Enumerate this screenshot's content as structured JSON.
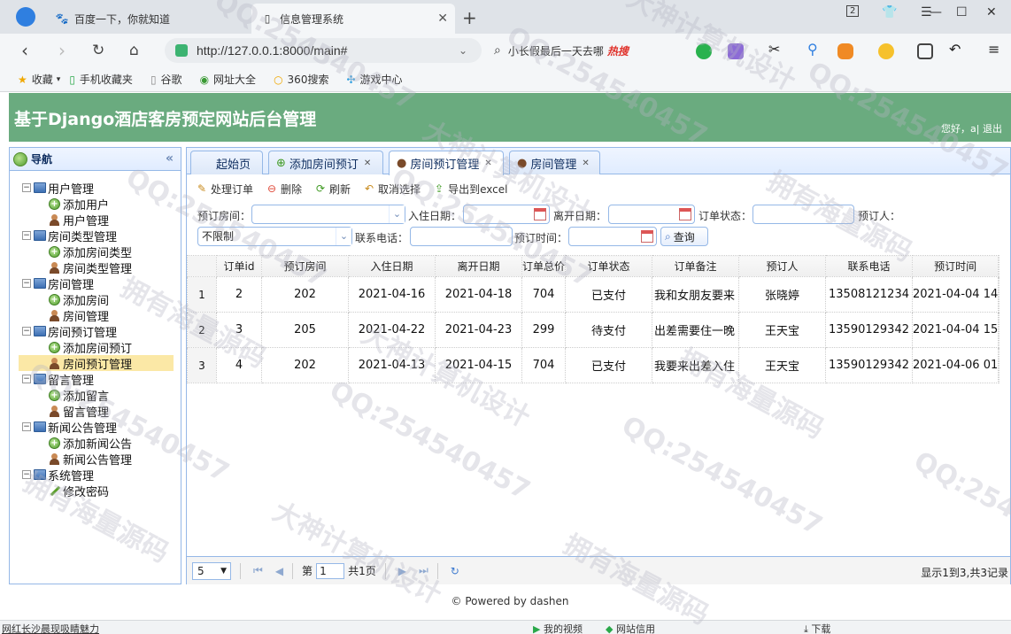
{
  "browser": {
    "tabs": [
      {
        "label": "百度一下，你就知道"
      },
      {
        "label": "信息管理系统"
      }
    ],
    "url": "http://127.0.0.1:8000/main#",
    "search_text": "小长假最后一天去哪",
    "search_hot": "热搜",
    "page_count_badge": "2",
    "bookmarks": [
      "收藏",
      "手机收藏夹",
      "谷歌",
      "网址大全",
      "360搜索",
      "游戏中心"
    ]
  },
  "header": {
    "title": "基于Django酒店客房预定网站后台管理",
    "welcome": "您好，a|",
    "logout": "退出"
  },
  "nav": {
    "title": "导航",
    "groups": [
      {
        "label": "用户管理",
        "children": [
          {
            "label": "添加用户",
            "icon": "add-icon"
          },
          {
            "label": "用户管理",
            "icon": "user-icon"
          }
        ]
      },
      {
        "label": "房间类型管理",
        "children": [
          {
            "label": "添加房间类型",
            "icon": "add-icon"
          },
          {
            "label": "房间类型管理",
            "icon": "user-icon"
          }
        ]
      },
      {
        "label": "房间管理",
        "children": [
          {
            "label": "添加房间",
            "icon": "add-icon"
          },
          {
            "label": "房间管理",
            "icon": "user-icon"
          }
        ]
      },
      {
        "label": "房间预订管理",
        "children": [
          {
            "label": "添加房间预订",
            "icon": "add-icon"
          },
          {
            "label": "房间预订管理",
            "icon": "user-icon"
          }
        ]
      },
      {
        "label": "留言管理",
        "children": [
          {
            "label": "添加留言",
            "icon": "add-icon"
          },
          {
            "label": "留言管理",
            "icon": "user-icon"
          }
        ]
      },
      {
        "label": "新闻公告管理",
        "children": [
          {
            "label": "添加新闻公告",
            "icon": "add-icon"
          },
          {
            "label": "新闻公告管理",
            "icon": "user-icon"
          }
        ]
      },
      {
        "label": "系统管理",
        "children": [
          {
            "label": "修改密码",
            "icon": "pencil-icon"
          }
        ]
      }
    ]
  },
  "content_tabs": [
    "起始页",
    "添加房间预订",
    "房间预订管理",
    "房间管理"
  ],
  "toolbar": {
    "process": "处理订单",
    "delete": "删除",
    "refresh": "刷新",
    "cancel_select": "取消选择",
    "export": "导出到excel"
  },
  "filters": {
    "room_label": "预订房间：",
    "checkin_label": "入住日期：",
    "checkout_label": "离开日期：",
    "status_label": "订单状态：",
    "booker_label": "预订人：",
    "status_value": "不限制",
    "phone_label": "联系电话：",
    "booktime_label": "预订时间：",
    "query": "查询"
  },
  "grid": {
    "columns": [
      "订单id",
      "预订房间",
      "入住日期",
      "离开日期",
      "订单总价",
      "订单状态",
      "订单备注",
      "预订人",
      "联系电话",
      "预订时间"
    ],
    "rows": [
      {
        "rn": "1",
        "cells": [
          "2",
          "202",
          "2021-04-16",
          "2021-04-18",
          "704",
          "已支付",
          "我和女朋友要来",
          "张晓婷",
          "13508121234",
          "2021-04-04 14"
        ]
      },
      {
        "rn": "2",
        "cells": [
          "3",
          "205",
          "2021-04-22",
          "2021-04-23",
          "299",
          "待支付",
          "出差需要住一晚",
          "王天宝",
          "13590129342",
          "2021-04-04 15"
        ]
      },
      {
        "rn": "3",
        "cells": [
          "4",
          "202",
          "2021-04-13",
          "2021-04-15",
          "704",
          "已支付",
          "我要来出差入住",
          "王天宝",
          "13590129342",
          "2021-04-06 01"
        ]
      }
    ]
  },
  "pager": {
    "page_size": "5",
    "page_prefix": "第",
    "page_value": "1",
    "page_suffix": "共1页",
    "info": "显示1到3,共3记录"
  },
  "footer": "© Powered by dashen",
  "statusbar": {
    "left": "网红长沙晨现吸睛魅力",
    "items": [
      "我的视频",
      "网站信用",
      "下载"
    ]
  },
  "watermarks": [
    "QQ:254540457",
    "大神计算机设计",
    "拥有海量源码"
  ]
}
